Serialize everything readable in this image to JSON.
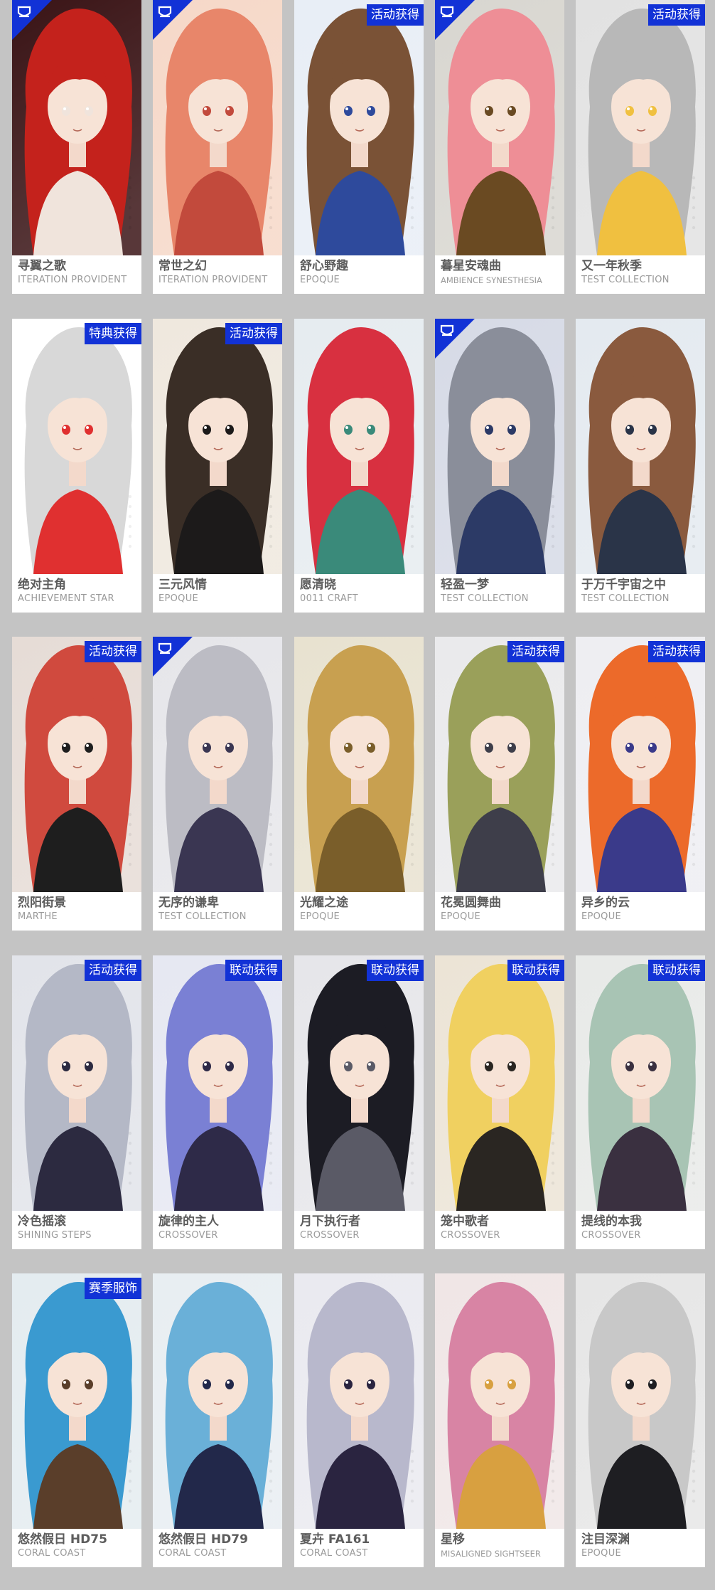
{
  "colors": {
    "background": "#c4c4c4",
    "card": "#ffffff",
    "badge": "#1232d6",
    "name_text": "#5c5c5c",
    "brand_text": "#9a9a9a"
  },
  "cards": [
    {
      "name": "寻翼之歌",
      "brand": "ITERATION PROVIDENT",
      "badge": "",
      "corner_icon": "premium-crest-icon",
      "palette": [
        "#3a1416",
        "#c4221c",
        "#f0e4dc"
      ]
    },
    {
      "name": "常世之幻",
      "brand": "ITERATION PROVIDENT",
      "badge": "",
      "corner_icon": "premium-crest-icon",
      "palette": [
        "#f6d8c8",
        "#e8866a",
        "#c24a3c"
      ]
    },
    {
      "name": "舒心野趣",
      "brand": "EPOQUE",
      "badge": "活动获得",
      "corner_icon": "",
      "palette": [
        "#e8eef6",
        "#7a5236",
        "#2e4a9c"
      ]
    },
    {
      "name": "暮星安魂曲",
      "brand": "AMBIENCE SYNESTHESIA",
      "badge": "",
      "corner_icon": "premium-crest-icon",
      "palette": [
        "#d8d6d0",
        "#ee8e96",
        "#6a4a22"
      ]
    },
    {
      "name": "又一年秋季",
      "brand": "TEST COLLECTION",
      "badge": "活动获得",
      "corner_icon": "",
      "palette": [
        "#e2e2e2",
        "#b8b8b8",
        "#f0c040"
      ]
    },
    {
      "name": "绝对主角",
      "brand": "ACHIEVEMENT STAR",
      "badge": "特典获得",
      "corner_icon": "",
      "palette": [
        "#ffffff",
        "#d8d8d8",
        "#e03030"
      ]
    },
    {
      "name": "三元风情",
      "brand": "EPOQUE",
      "badge": "活动获得",
      "corner_icon": "",
      "palette": [
        "#efe8de",
        "#3a2e26",
        "#1c1a1a"
      ]
    },
    {
      "name": "愿清晓",
      "brand": "0011 CRAFT",
      "badge": "",
      "corner_icon": "",
      "palette": [
        "#e6ecf0",
        "#d83040",
        "#3a8a7a"
      ]
    },
    {
      "name": "轻盈一梦",
      "brand": "TEST COLLECTION",
      "badge": "",
      "corner_icon": "premium-crest-icon",
      "palette": [
        "#d6dae6",
        "#8a8e9a",
        "#2c3a66"
      ]
    },
    {
      "name": "于万千宇宙之中",
      "brand": "TEST COLLECTION",
      "badge": "",
      "corner_icon": "",
      "palette": [
        "#e4eaf0",
        "#8a5a3e",
        "#2a3448"
      ]
    },
    {
      "name": "烈阳街景",
      "brand": "MARTHE",
      "badge": "活动获得",
      "corner_icon": "",
      "palette": [
        "#e6dcd6",
        "#d04a3e",
        "#1e1e1e"
      ]
    },
    {
      "name": "无序的谦卑",
      "brand": "TEST COLLECTION",
      "badge": "",
      "corner_icon": "premium-crest-icon",
      "palette": [
        "#e6e6ea",
        "#bcbcc4",
        "#3a3652"
      ]
    },
    {
      "name": "光耀之途",
      "brand": "EPOQUE",
      "badge": "",
      "corner_icon": "",
      "palette": [
        "#e8e2d0",
        "#c8a050",
        "#7a5e2a"
      ]
    },
    {
      "name": "花冕圆舞曲",
      "brand": "EPOQUE",
      "badge": "活动获得",
      "corner_icon": "",
      "palette": [
        "#eaeaec",
        "#9aa05a",
        "#3e3e4a"
      ]
    },
    {
      "name": "异乡的云",
      "brand": "EPOQUE",
      "badge": "活动获得",
      "corner_icon": "",
      "palette": [
        "#eeeef2",
        "#ec6a2a",
        "#3a3a8a"
      ]
    },
    {
      "name": "冷色摇滚",
      "brand": "SHINING STEPS",
      "badge": "活动获得",
      "corner_icon": "",
      "palette": [
        "#e2e4ea",
        "#b4b8c6",
        "#2c2a40"
      ]
    },
    {
      "name": "旋律的主人",
      "brand": "CROSSOVER",
      "badge": "联动获得",
      "corner_icon": "",
      "palette": [
        "#e6e8f2",
        "#7a80d4",
        "#2e2a48"
      ]
    },
    {
      "name": "月下执行者",
      "brand": "CROSSOVER",
      "badge": "联动获得",
      "corner_icon": "",
      "palette": [
        "#e6e6ea",
        "#1c1c24",
        "#5a5a66"
      ]
    },
    {
      "name": "笼中歌者",
      "brand": "CROSSOVER",
      "badge": "联动获得",
      "corner_icon": "",
      "palette": [
        "#ece4d6",
        "#f0d060",
        "#2a2622"
      ]
    },
    {
      "name": "提线的本我",
      "brand": "CROSSOVER",
      "badge": "联动获得",
      "corner_icon": "",
      "palette": [
        "#e8eae8",
        "#a8c4b4",
        "#3a3040"
      ]
    },
    {
      "name": "悠然假日 HD75",
      "brand": "CORAL COAST",
      "badge": "赛季服饰",
      "corner_icon": "",
      "palette": [
        "#e4ecf0",
        "#3a9ad0",
        "#5a3e2a"
      ]
    },
    {
      "name": "悠然假日 HD79",
      "brand": "CORAL COAST",
      "badge": "",
      "corner_icon": "",
      "palette": [
        "#e8eef2",
        "#6ab0d8",
        "#22284a"
      ]
    },
    {
      "name": "夏卉 FA161",
      "brand": "CORAL COAST",
      "badge": "",
      "corner_icon": "",
      "palette": [
        "#eaeaf0",
        "#b8b8cc",
        "#2a2440"
      ]
    },
    {
      "name": "星移",
      "brand": "MISALIGNED SIGHTSEER",
      "badge": "",
      "corner_icon": "",
      "palette": [
        "#f0e6e6",
        "#d884a4",
        "#d8a040"
      ]
    },
    {
      "name": "注目深渊",
      "brand": "EPOQUE",
      "badge": "",
      "corner_icon": "",
      "palette": [
        "#e6e6e6",
        "#c8c8c8",
        "#1e1e22"
      ]
    }
  ]
}
